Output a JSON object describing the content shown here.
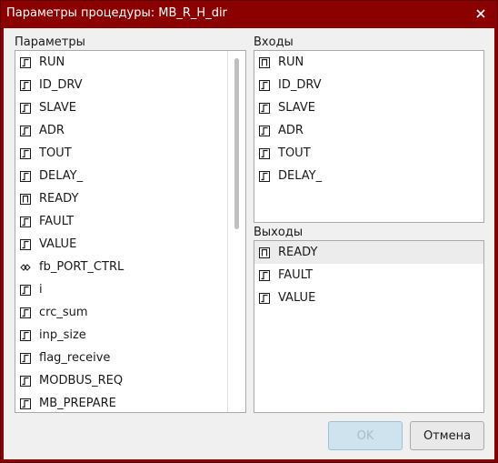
{
  "window": {
    "title": "Параметры процедуры: MB_R_H_dir",
    "close_glyph": "✕"
  },
  "params": {
    "label": "Параметры",
    "items": [
      {
        "label": "RUN",
        "icon": "signal-in-icon"
      },
      {
        "label": "ID_DRV",
        "icon": "signal-in-icon"
      },
      {
        "label": "SLAVE",
        "icon": "signal-in-icon"
      },
      {
        "label": "ADR",
        "icon": "signal-in-icon"
      },
      {
        "label": "TOUT",
        "icon": "signal-in-icon"
      },
      {
        "label": "DELAY_",
        "icon": "signal-in-icon"
      },
      {
        "label": "READY",
        "icon": "signal-out-icon"
      },
      {
        "label": "FAULT",
        "icon": "signal-in-icon"
      },
      {
        "label": "VALUE",
        "icon": "signal-in-icon"
      },
      {
        "label": "fb_PORT_CTRL",
        "icon": "function-block-icon"
      },
      {
        "label": "i",
        "icon": "signal-in-icon"
      },
      {
        "label": "crc_sum",
        "icon": "signal-in-icon"
      },
      {
        "label": "inp_size",
        "icon": "signal-in-icon"
      },
      {
        "label": "flag_receive",
        "icon": "signal-in-icon"
      },
      {
        "label": "MODBUS_REQ",
        "icon": "signal-in-icon"
      },
      {
        "label": "MB_PREPARE",
        "icon": "signal-in-icon"
      }
    ]
  },
  "inputs": {
    "label": "Входы",
    "items": [
      {
        "label": "RUN",
        "icon": "signal-out-icon"
      },
      {
        "label": "ID_DRV",
        "icon": "signal-in-icon"
      },
      {
        "label": "SLAVE",
        "icon": "signal-in-icon"
      },
      {
        "label": "ADR",
        "icon": "signal-in-icon"
      },
      {
        "label": "TOUT",
        "icon": "signal-in-icon"
      },
      {
        "label": "DELAY_",
        "icon": "signal-in-icon"
      }
    ]
  },
  "outputs": {
    "label": "Выходы",
    "items": [
      {
        "label": "READY",
        "icon": "signal-out-icon",
        "selected": true
      },
      {
        "label": "FAULT",
        "icon": "signal-in-icon"
      },
      {
        "label": "VALUE",
        "icon": "signal-in-icon"
      }
    ]
  },
  "buttons": {
    "ok": "OK",
    "cancel": "Отмена"
  },
  "colors": {
    "title_bar": "#8b0000",
    "selection": "#ececec",
    "ok_button": "#cfe3ef"
  }
}
